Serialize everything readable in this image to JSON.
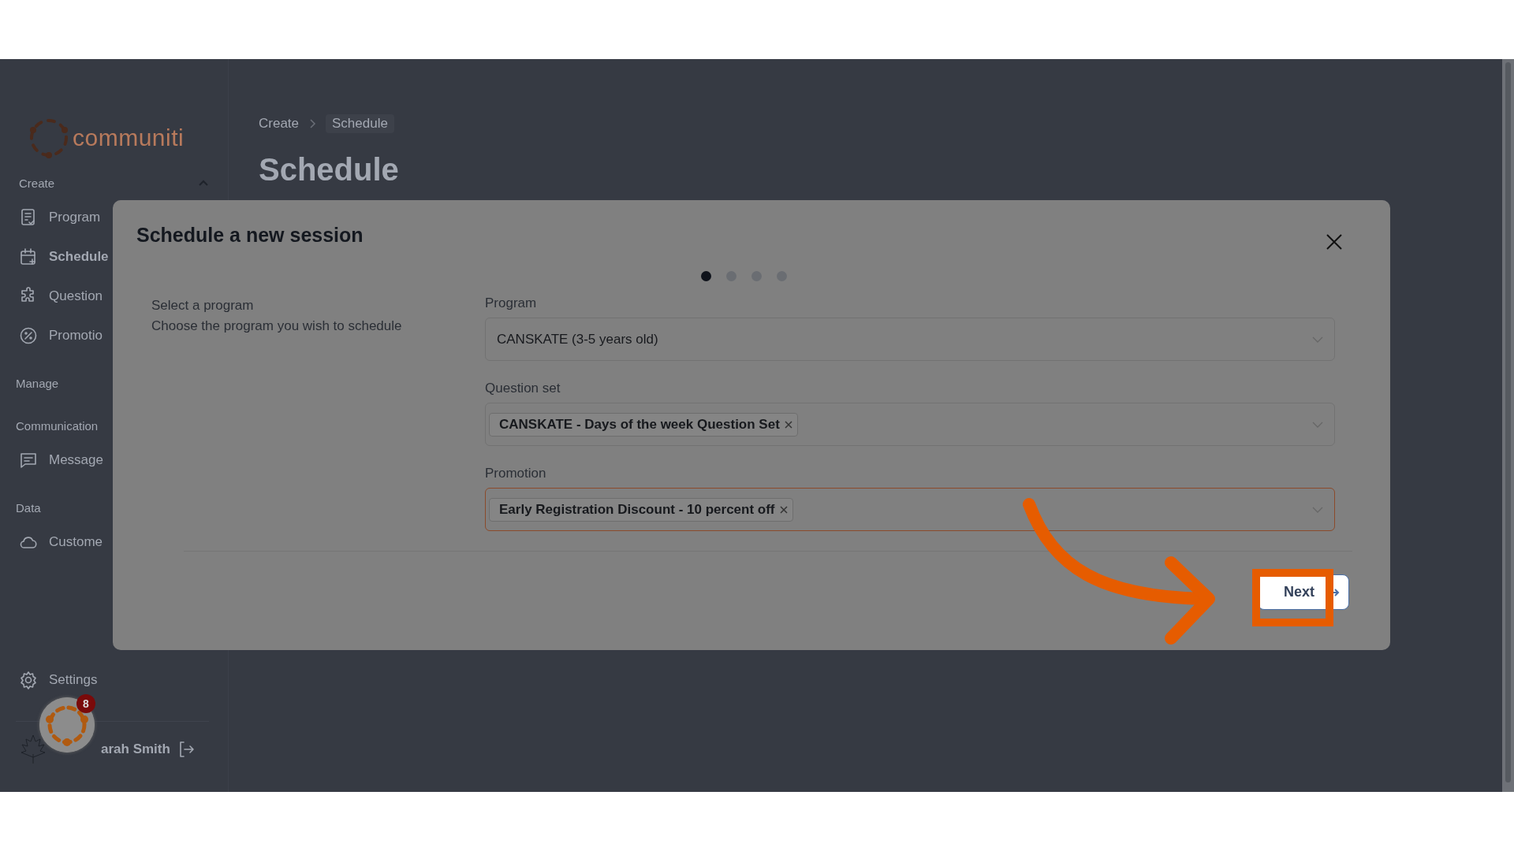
{
  "brand": {
    "name": "communiti"
  },
  "sidebar": {
    "sections": [
      {
        "title": "Create",
        "expanded": true,
        "items": [
          {
            "label": "Program",
            "kind": "document",
            "selected": false
          },
          {
            "label": "Schedule",
            "kind": "calendar",
            "selected": true
          },
          {
            "label": "Question",
            "kind": "puzzle",
            "selected": false
          },
          {
            "label": "Promotio",
            "kind": "percent",
            "selected": false
          }
        ]
      },
      {
        "title": "Manage"
      },
      {
        "title": "Communication",
        "items": [
          {
            "label": "Message",
            "kind": "chat",
            "selected": false
          }
        ]
      },
      {
        "title": "Data",
        "items": [
          {
            "label": "Custome",
            "kind": "cloud",
            "selected": false
          }
        ]
      }
    ],
    "settings": "Settings",
    "user": "arah Smith",
    "notification_count": "8"
  },
  "breadcrumb": [
    "Create",
    "Schedule"
  ],
  "page_title": "Schedule",
  "modal": {
    "title": "Schedule a new session",
    "steps": [
      {
        "selected": true
      },
      {
        "selected": false
      },
      {
        "selected": false
      },
      {
        "selected": false
      }
    ],
    "step_title": "Select a program",
    "step_description": "Choose the program you wish to schedule",
    "fields": [
      {
        "label": "Program",
        "value": "CANSKATE (3-5 years old)",
        "focused": false
      },
      {
        "label": "Question set",
        "tags": [
          "CANSKATE - Days of the week Question Set"
        ],
        "focused": false
      },
      {
        "label": "Promotion",
        "tags": [
          "Early Registration Discount - 10 percent off"
        ],
        "focused": true
      }
    ],
    "next_button": "Next"
  }
}
